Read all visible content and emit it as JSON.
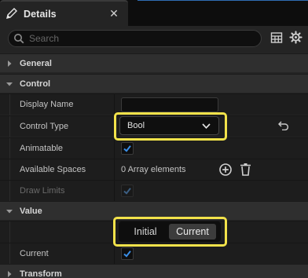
{
  "tab": {
    "title": "Details",
    "close_glyph": "✕",
    "icon": "pencil-icon"
  },
  "search": {
    "placeholder": "Search",
    "value": ""
  },
  "toolbar": {
    "grid_icon": "table-view-icon",
    "settings_icon": "gear-icon"
  },
  "categories": {
    "general": "General",
    "control": "Control",
    "value": "Value",
    "transform": "Transform"
  },
  "control": {
    "display_name_label": "Display Name",
    "display_name_value": "",
    "control_type_label": "Control Type",
    "control_type_value": "Bool",
    "animatable_label": "Animatable",
    "animatable_checked": true,
    "available_spaces_label": "Available Spaces",
    "available_spaces_value": "0 Array elements",
    "draw_limits_label": "Draw Limits",
    "draw_limits_checked": true
  },
  "value": {
    "mode_initial": "Initial",
    "mode_current": "Current",
    "selected_mode": "Current",
    "current_label": "Current",
    "current_checked": true
  },
  "colors": {
    "highlight": "#f2e24a",
    "check": "#3a8ee6",
    "tab_accent": "#2f6db3"
  }
}
